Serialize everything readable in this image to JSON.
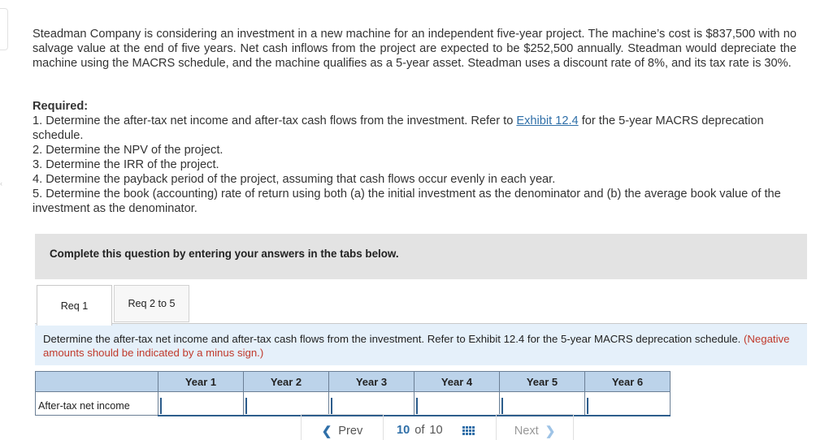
{
  "question": {
    "paragraph": "Steadman Company is considering an investment in a new machine for an independent five-year project. The machine’s cost is $837,500 with no salvage value at the end of five years. Net cash inflows from the project are expected to be $252,500 annually. Steadman would depreciate the machine using the MACRS schedule, and the machine qualifies as a 5-year asset. Steadman uses a discount rate of 8%, and its tax rate is 30%."
  },
  "required": {
    "title": "Required:",
    "item1_before": "1. Determine the after-tax net income and after-tax cash flows from the investment. Refer to ",
    "item1_link": "Exhibit 12.4",
    "item1_after": " for the 5-year MACRS deprecation schedule.",
    "item2": "2. Determine the NPV of the project.",
    "item3": "3. Determine the IRR of the project.",
    "item4": "4. Determine the payback period of the project, assuming that cash flows occur evenly in each year.",
    "item5": "5. Determine the book (accounting) rate of return using both (a) the initial investment as the denominator and (b) the average book value of the investment as the denominator."
  },
  "instruction": "Complete this question by entering your answers in the tabs below.",
  "tabs": [
    {
      "label": "Req 1"
    },
    {
      "label": "Req 2 to 5"
    }
  ],
  "task": {
    "text": "Determine the after-tax net income and after-tax cash flows from the investment. Refer to Exhibit 12.4 for the 5-year MACRS deprecation schedule. ",
    "note": "(Negative amounts should be indicated by a minus sign.)"
  },
  "table": {
    "headers": [
      "",
      "Year 1",
      "Year 2",
      "Year 3",
      "Year 4",
      "Year 5",
      "Year 6"
    ],
    "rows": [
      {
        "label": "After-tax net income",
        "values": [
          "",
          "",
          "",
          "",
          "",
          ""
        ]
      }
    ]
  },
  "pager": {
    "prev_label": "Prev",
    "current": "10",
    "of_label": "of",
    "total": "10",
    "next_label": "Next"
  },
  "icons": {
    "prev": "chevron-left-icon",
    "next": "chevron-right-icon",
    "grid": "grid-icon"
  },
  "colors": {
    "link": "#2f6fa8",
    "note": "#c0392b",
    "header": "#bcd3ea",
    "task_panel": "#e5f0fa"
  }
}
